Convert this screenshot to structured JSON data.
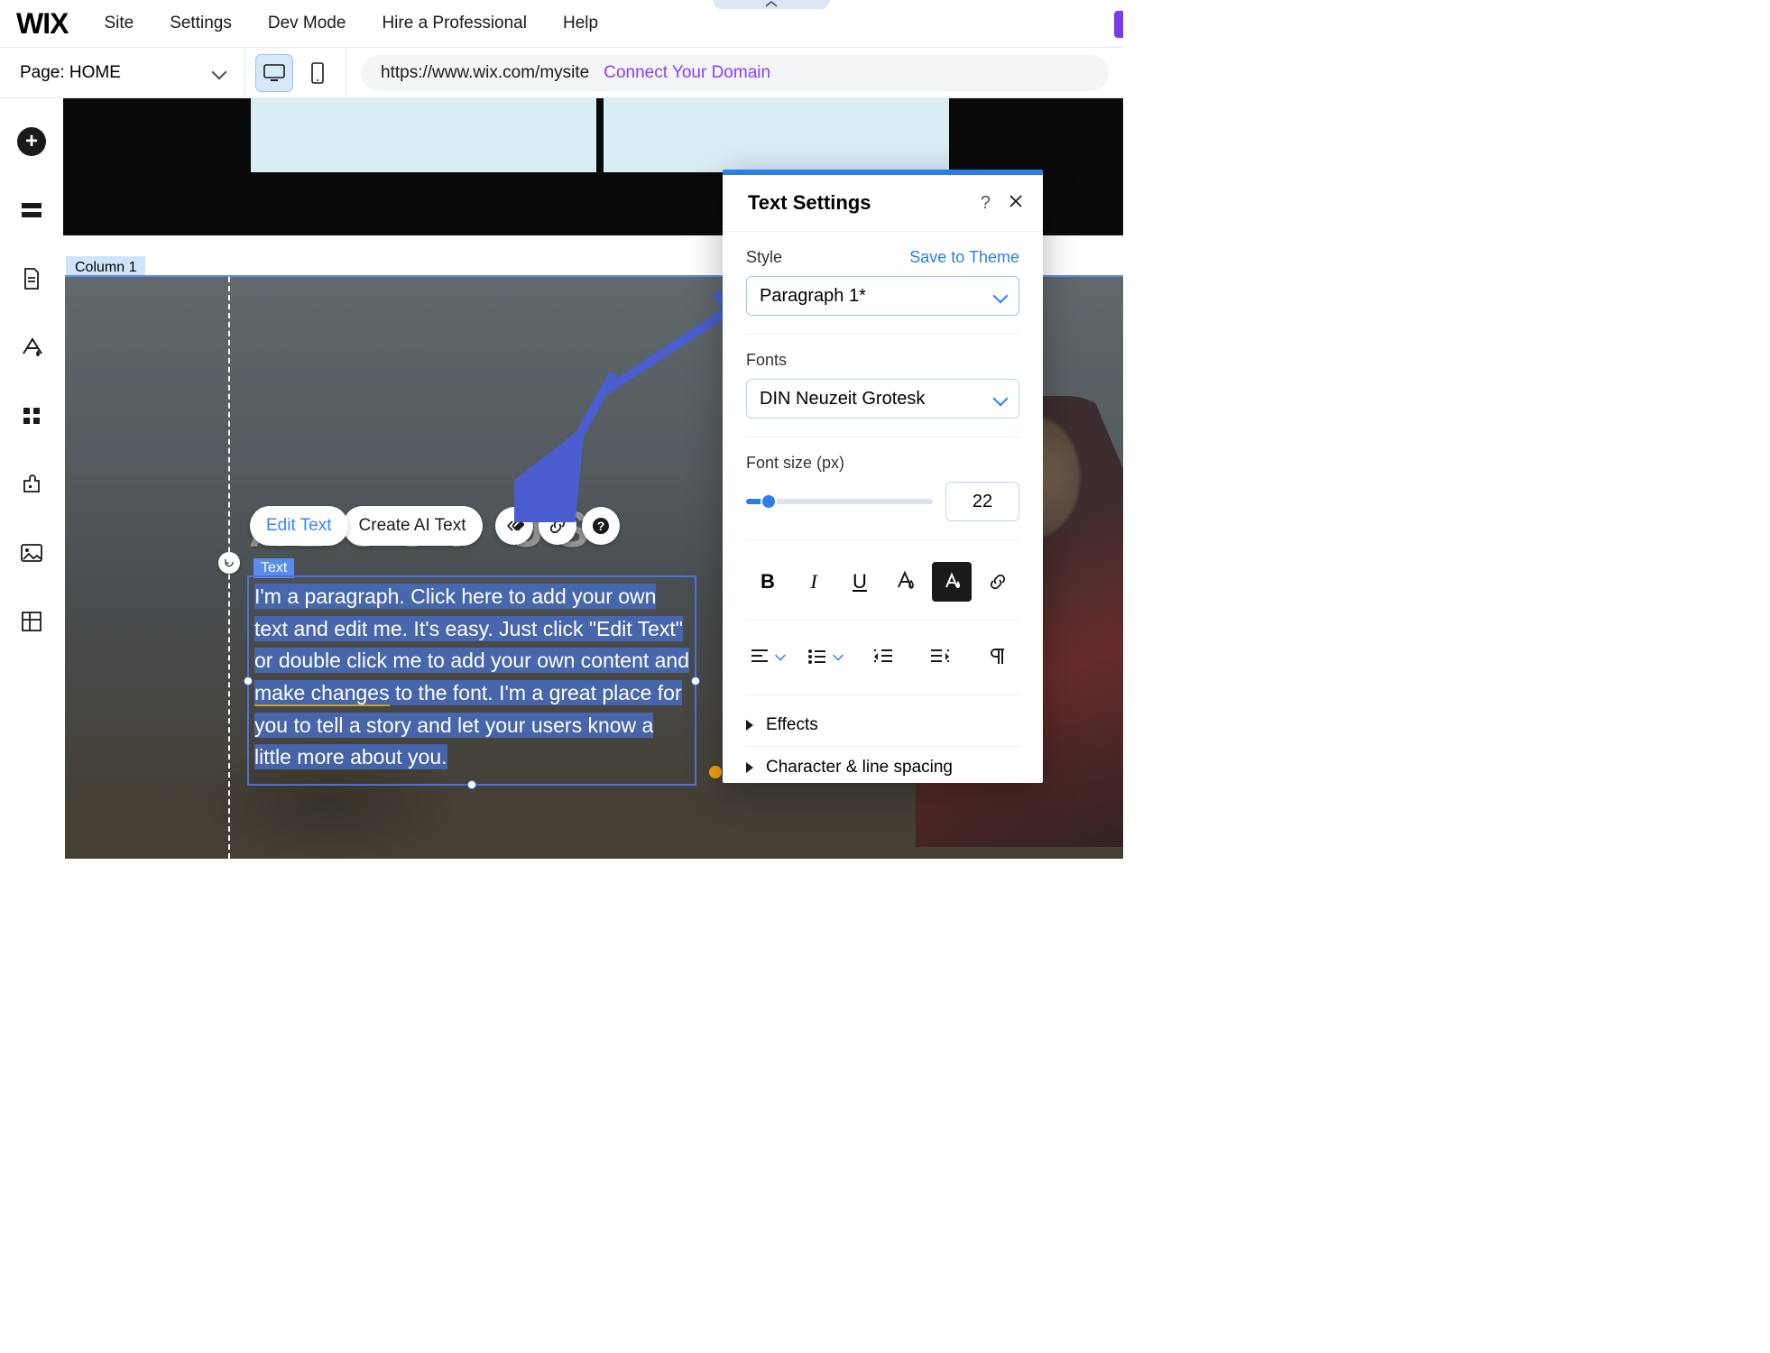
{
  "top_menu": {
    "logo": "WIX",
    "items": [
      "Site",
      "Settings",
      "Dev Mode",
      "Hire a Professional",
      "Help"
    ]
  },
  "page_bar": {
    "page_label": "Page: HOME",
    "url": "https://www.wix.com/mysite",
    "connect_domain": "Connect Your Domain"
  },
  "canvas": {
    "column_tag": "Column 1",
    "heading": "ABOUT US",
    "text_label": "Text",
    "paragraph_pre": "I'm a paragraph. Click here to add your own text and edit me. It's easy. Just click \"Edit Text\" or double click me to add your own content and ",
    "paragraph_mc": "make changes",
    "paragraph_post": " to the font. I'm a great place for you to tell a story and let your users know a little more about you.",
    "actions": {
      "edit_text": "Edit Text",
      "create_ai": "Create AI Text"
    }
  },
  "panel": {
    "title": "Text Settings",
    "style_label": "Style",
    "save_theme": "Save to Theme",
    "style_value": "Paragraph 1*",
    "fonts_label": "Fonts",
    "font_value": "DIN Neuzeit Grotesk",
    "fontsize_label": "Font size (px)",
    "fontsize_value": "22",
    "effects_label": "Effects",
    "spacing_label": "Character & line spacing"
  }
}
